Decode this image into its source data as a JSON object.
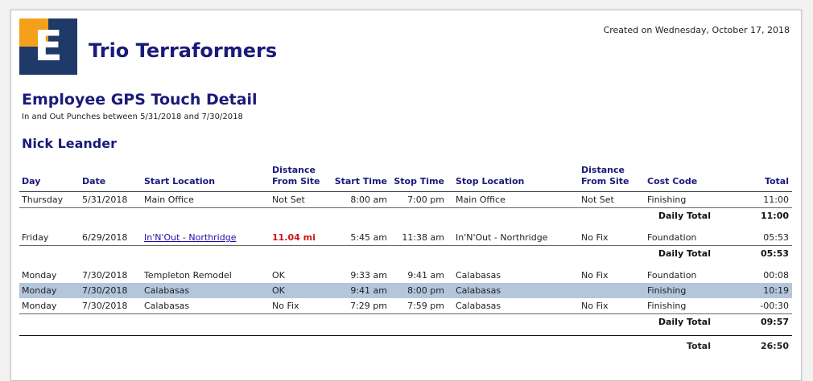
{
  "header": {
    "logo_letter": "E",
    "company": "Trio Terraformers",
    "created": "Created on Wednesday, October 17, 2018",
    "title": "Employee GPS Touch Detail",
    "subtitle": "In and Out Punches between 5/31/2018 and 7/30/2018",
    "employee": "Nick Leander"
  },
  "columns": {
    "day": "Day",
    "date": "Date",
    "start_location": "Start Location",
    "distance1_line1": "Distance",
    "distance1_line2": "From Site",
    "start_time": "Start Time",
    "stop_time": "Stop Time",
    "stop_location": "Stop Location",
    "distance2_line1": "Distance",
    "distance2_line2": "From Site",
    "cost_code": "Cost Code",
    "total": "Total"
  },
  "groups": [
    {
      "rows": [
        {
          "day": "Thursday",
          "date": "5/31/2018",
          "start": "Main Office",
          "dist1": "Not Set",
          "stime": "8:00 am",
          "etime": "7:00 pm",
          "stop": "Main Office",
          "dist2": "Not Set",
          "cost": "Finishing",
          "total": "11:00"
        }
      ],
      "daily_label": "Daily Total",
      "daily_total": "11:00"
    },
    {
      "rows": [
        {
          "day": "Friday",
          "date": "6/29/2018",
          "start": "In'N'Out - Northridge",
          "dist1": "11.04 mi",
          "stime": "5:45 am",
          "etime": "11:38 am",
          "stop": "In'N'Out - Northridge",
          "dist2": "No Fix",
          "cost": "Foundation",
          "total": "05:53"
        }
      ],
      "daily_label": "Daily Total",
      "daily_total": "05:53"
    },
    {
      "rows": [
        {
          "day": "Monday",
          "date": "7/30/2018",
          "start": "Templeton Remodel",
          "dist1": "OK",
          "stime": "9:33 am",
          "etime": "9:41 am",
          "stop": "Calabasas",
          "dist2": "No Fix",
          "cost": "Foundation",
          "total": "00:08"
        },
        {
          "day": "Monday",
          "date": "7/30/2018",
          "start": "Calabasas",
          "dist1": "OK",
          "stime": "9:41 am",
          "etime": "8:00 pm",
          "stop": "Calabasas",
          "dist2": "",
          "cost": "Finishing",
          "total": "10:19"
        },
        {
          "day": "Monday",
          "date": "7/30/2018",
          "start": "Calabasas",
          "dist1": "No Fix",
          "stime": "7:29 pm",
          "etime": "7:59 pm",
          "stop": "Calabasas",
          "dist2": "No Fix",
          "cost": "Finishing",
          "total": "-00:30"
        }
      ],
      "daily_label": "Daily Total",
      "daily_total": "09:57"
    }
  ],
  "grand": {
    "label": "Total",
    "value": "26:50"
  }
}
